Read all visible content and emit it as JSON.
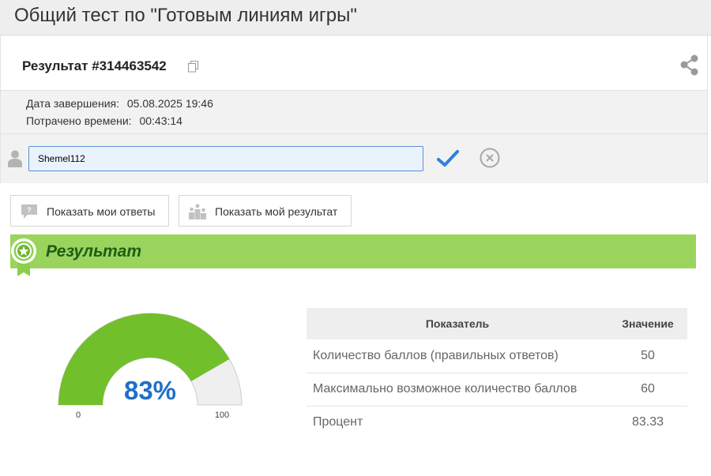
{
  "page": {
    "title": "Общий тест по \"Готовым линиям игры\""
  },
  "result": {
    "title": "Результат #314463542"
  },
  "meta": {
    "finish_label": "Дата завершения:",
    "finish_value": "05.08.2025 19:46",
    "time_label": "Потрачено времени:",
    "time_value": "00:43:14"
  },
  "name_input": {
    "value": "Shemel112"
  },
  "buttons": {
    "show_answers": "Показать мои ответы",
    "show_result": "Показать мой результат"
  },
  "banner": {
    "title": "Результат"
  },
  "gauge": {
    "value_label": "83%",
    "percent": 83.33,
    "min_label": "0",
    "max_label": "100"
  },
  "table": {
    "headers": [
      "Показатель",
      "Значение"
    ],
    "rows": [
      [
        "Количество баллов (правильных ответов)",
        "50"
      ],
      [
        "Максимально возможное количество баллов",
        "60"
      ],
      [
        "Процент",
        "83.33"
      ]
    ]
  },
  "colors": {
    "gauge_fill": "#72bf2c",
    "gauge_track": "#efefef",
    "gauge_text": "#1f6fc6",
    "banner_bg": "#9ad45d",
    "banner_text": "#1f5c14",
    "check_icon": "#2f7fe0"
  },
  "icons": {
    "copy": "copy-icon",
    "share": "share-icon",
    "user": "user-icon",
    "check": "check-icon",
    "cancel": "close-circle-icon",
    "answers": "speech-bubble-question-icon",
    "result": "podium-icon",
    "rosette": "award-ribbon-icon"
  }
}
